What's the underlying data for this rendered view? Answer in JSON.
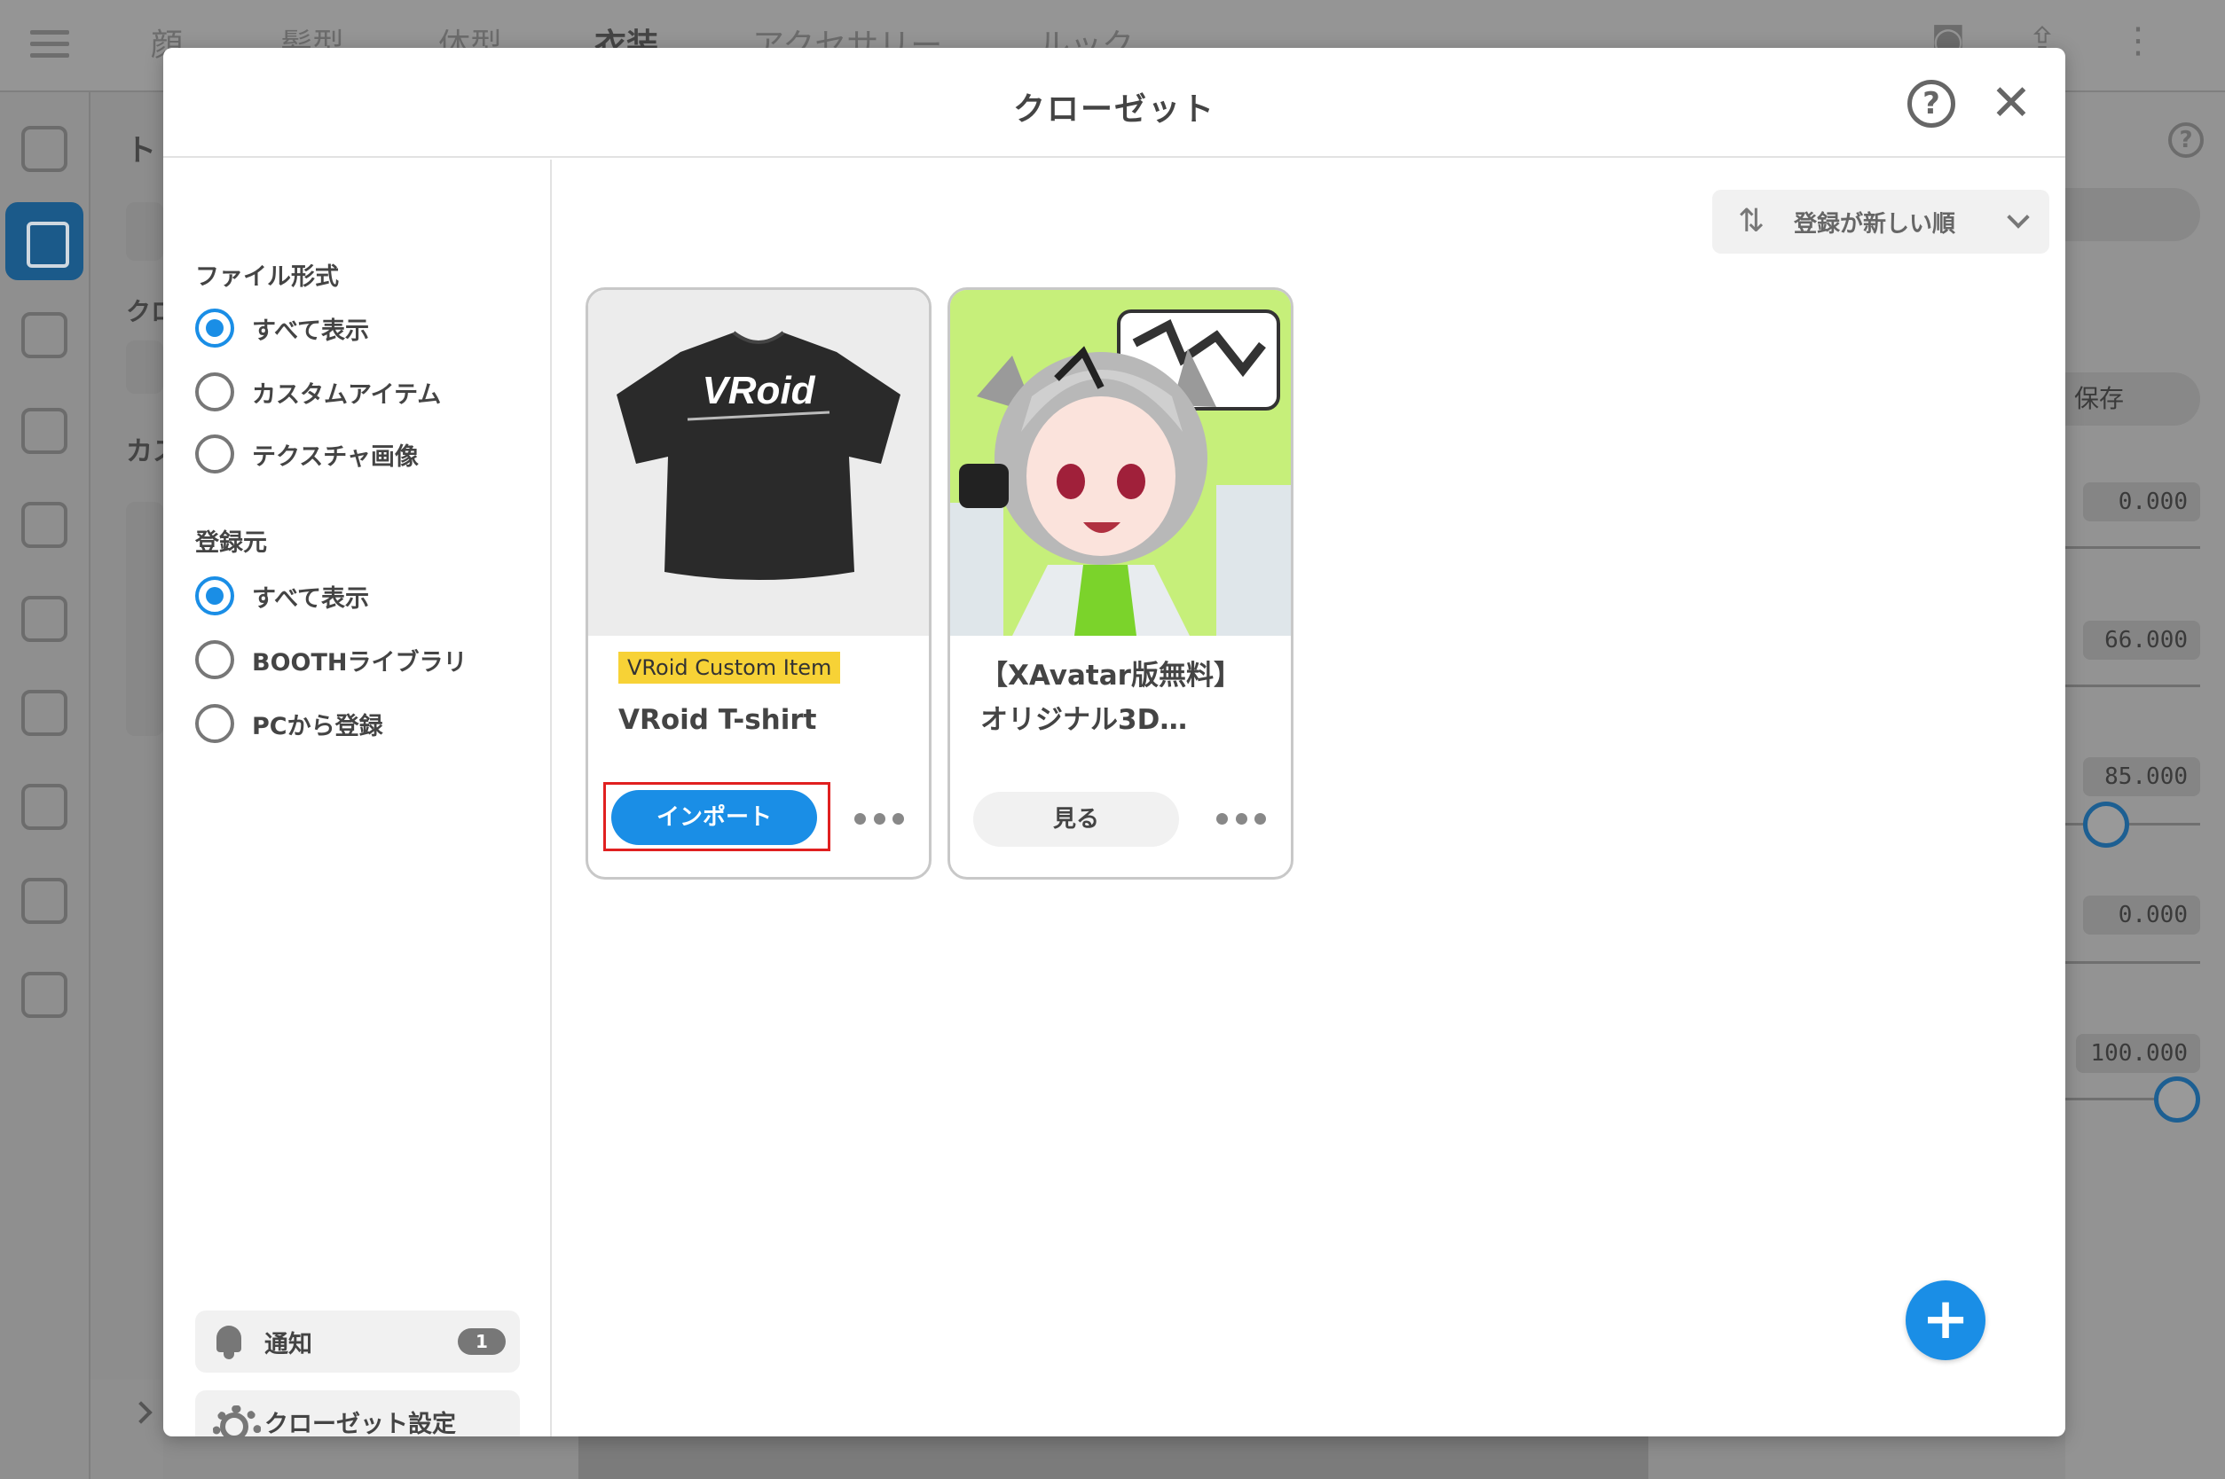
{
  "background": {
    "tabs": [
      "顔",
      "髪型",
      "体型",
      "衣装",
      "アクセサリー",
      "ルック"
    ],
    "active_tab": "衣装",
    "left_text_1": "ト",
    "left_text_2": "クロ",
    "left_text_3": "カス",
    "save_text": "保存",
    "values": [
      "0.000",
      "66.000",
      "85.000",
      "0.000",
      "100.000"
    ]
  },
  "modal": {
    "title": "クローゼット",
    "filters": {
      "file_type_label": "ファイル形式",
      "file_type_options": [
        "すべて表示",
        "カスタムアイテム",
        "テクスチャ画像"
      ],
      "file_type_selected": 0,
      "source_label": "登録元",
      "source_options": [
        "すべて表示",
        "BOOTHライブラリ",
        "PCから登録"
      ],
      "source_selected": 0
    },
    "notifications": {
      "label": "通知",
      "count": "1"
    },
    "closet_settings": {
      "label": "クローゼット設定"
    },
    "sort": {
      "label": "登録が新しい順"
    },
    "cards": [
      {
        "tag": "VRoid Custom Item",
        "title": "VRoid T-shirt",
        "action": "インポート",
        "thumb_text": "VRoid"
      },
      {
        "tag": "",
        "title_line1": "【XAvatar版無料】",
        "title_line2": "オリジナル3D…",
        "action": "見る"
      }
    ]
  },
  "colors": {
    "accent": "#1a8ee6",
    "tag": "#f7d236",
    "highlight": "#e02020"
  }
}
